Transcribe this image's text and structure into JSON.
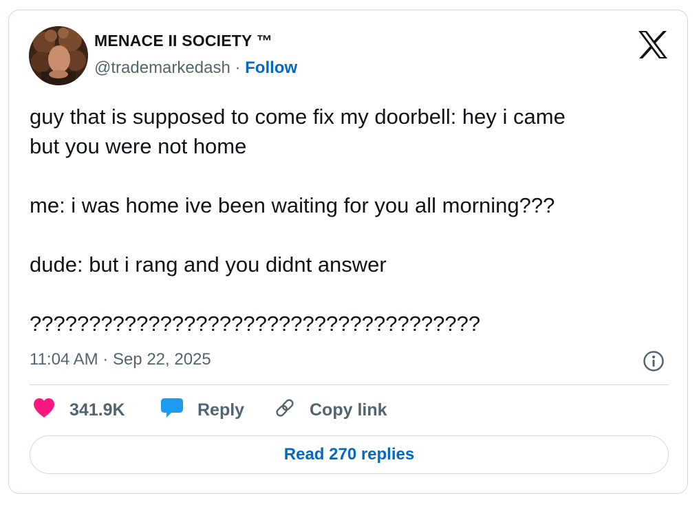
{
  "author": {
    "display_name": "MENACE II SOCIETY ™",
    "handle": "@trademarkedash",
    "separator": " · ",
    "follow_label": "Follow"
  },
  "tweet": {
    "text": "guy that is supposed to come fix my doorbell: hey i came\nbut you were not home\n\nme: i was home ive been waiting for you all morning???\n\ndude: but i rang and you didnt answer\n\n??????????????????????????????????????",
    "timestamp": "11:04 AM · Sep 22, 2025"
  },
  "actions": {
    "like_count": "341.9K",
    "reply_label": "Reply",
    "copy_link_label": "Copy link"
  },
  "read_replies_label": "Read 270 replies",
  "icons": {
    "logo": "x-logo-icon",
    "info": "info-icon",
    "like": "heart-icon",
    "reply": "speech-bubble-icon",
    "copy_link": "link-icon"
  },
  "colors": {
    "like": "#f91880",
    "reply": "#1d9bf0",
    "link": "#0068c9",
    "secondary_text": "#536471",
    "border": "#cfd9de"
  }
}
